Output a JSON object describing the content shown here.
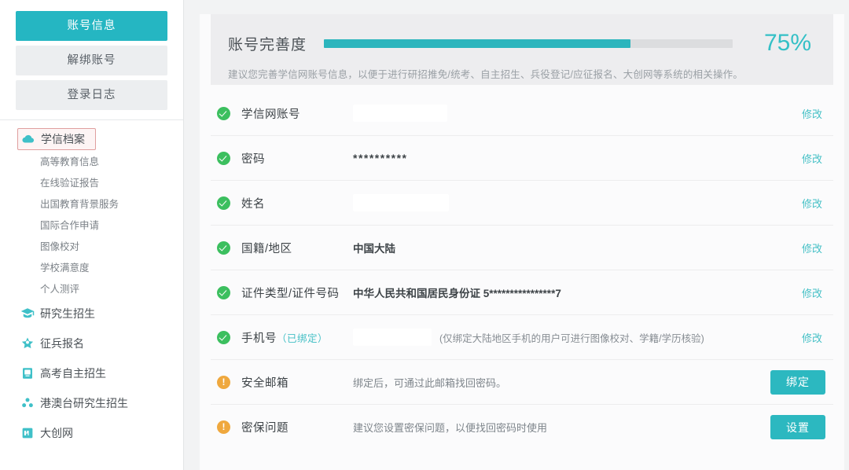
{
  "sidebar": {
    "account_buttons": [
      {
        "label": "账号信息",
        "active": true
      },
      {
        "label": "解绑账号",
        "active": false
      },
      {
        "label": "登录日志",
        "active": false
      }
    ],
    "archive_group": {
      "label": "学信档案",
      "icon": "cloud-icon",
      "selected": true,
      "sub_items": [
        {
          "label": "高等教育信息"
        },
        {
          "label": "在线验证报告"
        },
        {
          "label": "出国教育背景服务"
        },
        {
          "label": "国际合作申请"
        },
        {
          "label": "图像校对"
        },
        {
          "label": "学校满意度"
        },
        {
          "label": "个人测评"
        }
      ]
    },
    "items": [
      {
        "label": "研究生招生",
        "icon": "graduation-cap-icon"
      },
      {
        "label": "征兵报名",
        "icon": "star-badge-icon"
      },
      {
        "label": "高考自主招生",
        "icon": "book-icon"
      },
      {
        "label": "港澳台研究生招生",
        "icon": "people-group-icon"
      },
      {
        "label": "大创网",
        "icon": "innovation-icon"
      }
    ]
  },
  "progress": {
    "title": "账号完善度",
    "percent_label": "75%",
    "percent_value": 75,
    "description": "建议您完善学信网账号信息，以便于进行研招推免/统考、自主招生、兵役登记/应征报名、大创网等系统的相关操作。"
  },
  "rows": [
    {
      "status": "ok",
      "label": "学信网账号",
      "badge": "",
      "value": "",
      "masked": true,
      "mask_width": 120,
      "hint": "",
      "desc": "",
      "action": "修改",
      "button": ""
    },
    {
      "status": "ok",
      "label": "密码",
      "badge": "",
      "value": "**********",
      "masked": false,
      "mask_width": 0,
      "hint": "",
      "desc": "",
      "action": "修改",
      "button": ""
    },
    {
      "status": "ok",
      "label": "姓名",
      "badge": "",
      "value": "",
      "masked": true,
      "mask_width": 122,
      "hint": "",
      "desc": "",
      "action": "修改",
      "button": ""
    },
    {
      "status": "ok",
      "label": "国籍/地区",
      "badge": "",
      "value": "中国大陆",
      "masked": false,
      "mask_width": 0,
      "hint": "",
      "desc": "",
      "action": "修改",
      "button": ""
    },
    {
      "status": "ok",
      "label": "证件类型/证件号码",
      "badge": "",
      "value": "中华人民共和国居民身份证   5****************7",
      "masked": false,
      "mask_width": 0,
      "hint": "",
      "desc": "",
      "action": "修改",
      "button": ""
    },
    {
      "status": "ok",
      "label": "手机号",
      "badge": "（已绑定）",
      "value": "",
      "masked": true,
      "mask_width": 100,
      "hint": "(仅绑定大陆地区手机的用户可进行图像校对、学籍/学历核验)",
      "desc": "",
      "action": "修改",
      "button": ""
    },
    {
      "status": "warn",
      "label": "安全邮箱",
      "badge": "",
      "value": "",
      "masked": false,
      "mask_width": 0,
      "hint": "",
      "desc": "绑定后，可通过此邮箱找回密码。",
      "action": "",
      "button": "绑定"
    },
    {
      "status": "warn",
      "label": "密保问题",
      "badge": "",
      "value": "",
      "masked": false,
      "mask_width": 0,
      "hint": "",
      "desc": "建议您设置密保问题，以便找回密码时使用",
      "action": "",
      "button": "设置"
    }
  ],
  "colors": {
    "accent": "#2cb8c0",
    "accent_text": "#45c0c6",
    "progress_fill": "#2cb5bd",
    "status_ok": "#3cbf5f",
    "status_warn": "#efa83e",
    "selected_outline": "#e09f9f"
  }
}
